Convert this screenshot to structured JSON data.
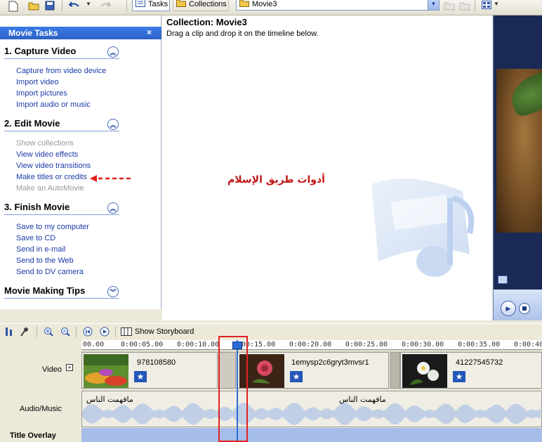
{
  "toolbar": {
    "tasks_label": "Tasks",
    "collections_label": "Collections",
    "collection_combo_value": "Movie3"
  },
  "task_pane": {
    "header": "Movie Tasks",
    "close_glyph": "×",
    "sections": [
      {
        "title": "1. Capture Video",
        "items": [
          {
            "label": "Capture from video device",
            "enabled": true
          },
          {
            "label": "Import video",
            "enabled": true
          },
          {
            "label": "Import pictures",
            "enabled": true
          },
          {
            "label": "Import audio or music",
            "enabled": true
          }
        ]
      },
      {
        "title": "2. Edit Movie",
        "items": [
          {
            "label": "Show collections",
            "enabled": false
          },
          {
            "label": "View video effects",
            "enabled": true
          },
          {
            "label": "View video transitions",
            "enabled": true
          },
          {
            "label": "Make titles or credits",
            "enabled": true
          },
          {
            "label": "Make an AutoMovie",
            "enabled": false
          }
        ]
      },
      {
        "title": "3. Finish Movie",
        "items": [
          {
            "label": "Save to my computer",
            "enabled": true
          },
          {
            "label": "Save to CD",
            "enabled": true
          },
          {
            "label": "Send in e-mail",
            "enabled": true
          },
          {
            "label": "Send to the Web",
            "enabled": true
          },
          {
            "label": "Send to DV camera",
            "enabled": true
          }
        ]
      },
      {
        "title": "Movie Making Tips",
        "items": []
      }
    ]
  },
  "collection": {
    "title": "Collection: Movie3",
    "subtitle": "Drag a clip and drop it on the timeline below.",
    "annotation_arabic": "أدوات طريق الإسلام"
  },
  "timeline": {
    "show_storyboard_label": "Show Storyboard",
    "ruler_ticks": [
      "00.00",
      "0:00:05.00",
      "0:00:10.00",
      "0:00:15.00",
      "0:00:20.00",
      "0:00:25.00",
      "0:00:30.00",
      "0:00:35.00",
      "0:00:40."
    ],
    "tracks": {
      "video_label": "Video",
      "audio_label": "Audio/Music",
      "overlay_label": "Title Overlay"
    },
    "clips": [
      {
        "name": "978108580"
      },
      {
        "name": "1emysp2c6gryt3mvsr1"
      },
      {
        "name": "41227545732"
      }
    ],
    "audio_clips": [
      {
        "name": "مافهمت الناس"
      },
      {
        "name": "مافهمت الناس"
      }
    ]
  },
  "colors": {
    "task_header": "#2d62c6",
    "link": "#1b3aa8",
    "highlight_box": "#e02020",
    "annotation": "#c21515",
    "playhead": "#2c6bd6"
  }
}
